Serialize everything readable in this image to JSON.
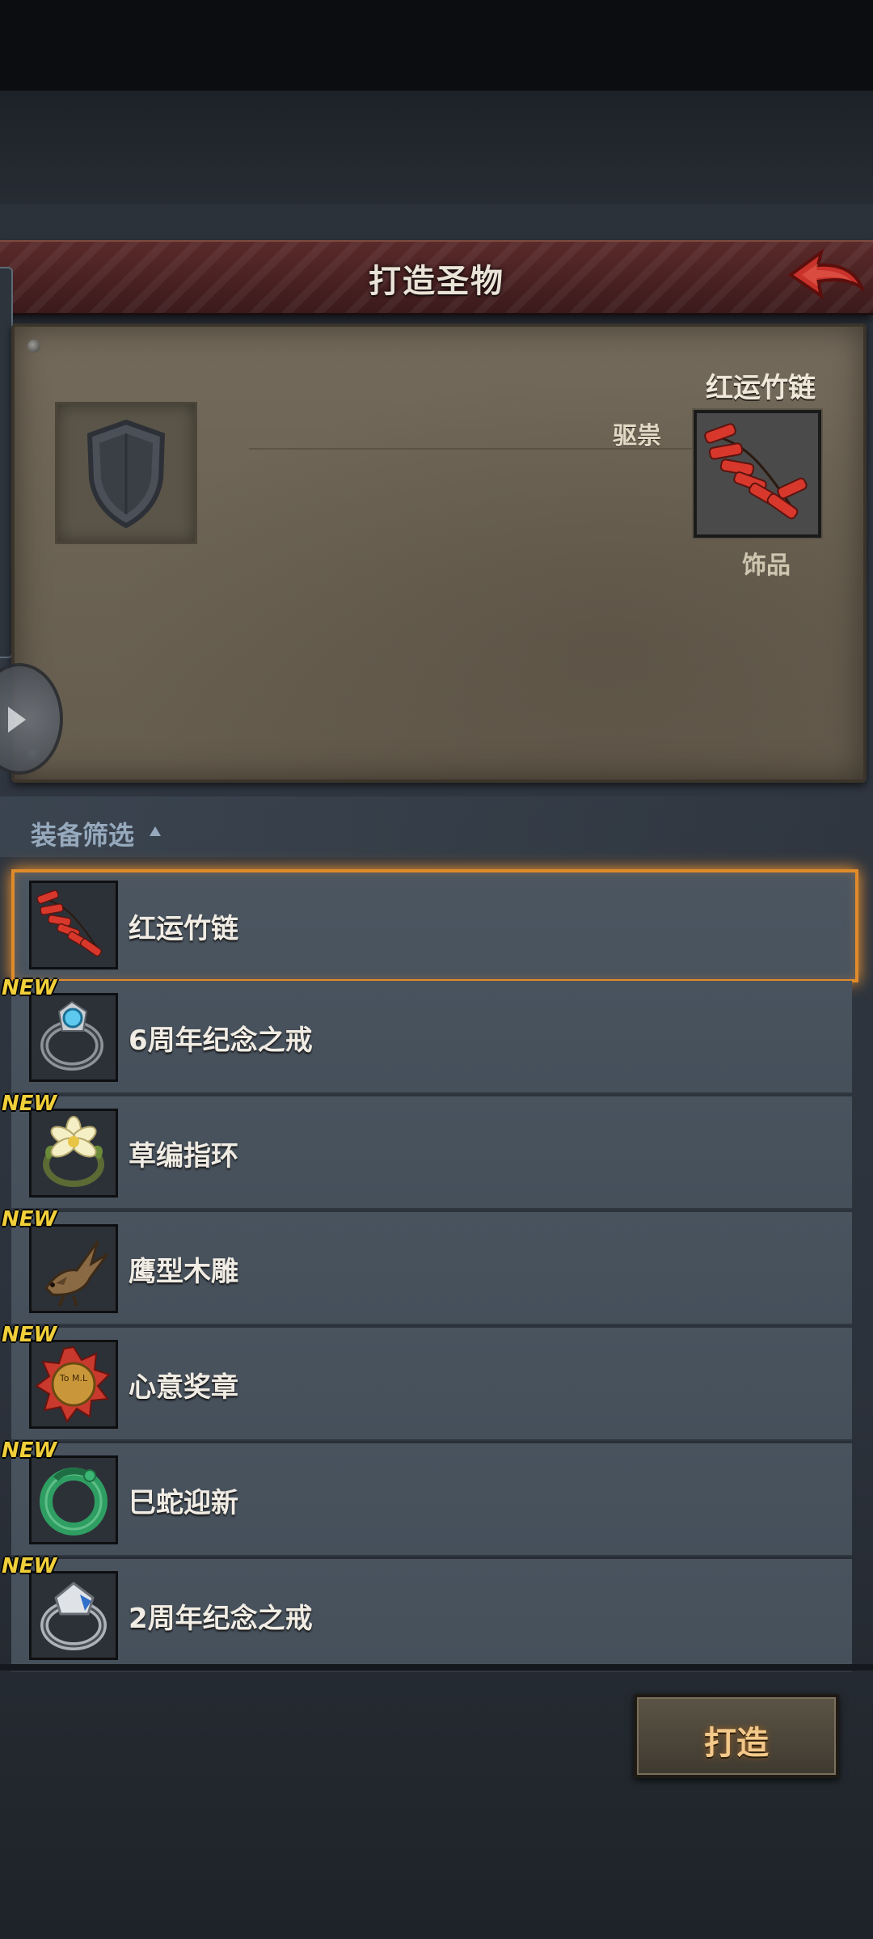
{
  "header": {
    "title": "打造圣物"
  },
  "preview": {
    "attribute": "驱祟",
    "item_name": "红运竹链",
    "item_type": "饰品"
  },
  "filter": {
    "label": "装备筛选"
  },
  "list": {
    "new_badge": "NEW",
    "items": [
      {
        "label": "红运竹链",
        "is_new": false,
        "selected": true,
        "icon": "firecracker-chain-icon"
      },
      {
        "label": "6周年纪念之戒",
        "is_new": true,
        "selected": false,
        "icon": "blue-gem-ring-icon"
      },
      {
        "label": "草编指环",
        "is_new": true,
        "selected": false,
        "icon": "flower-ring-icon"
      },
      {
        "label": "鹰型木雕",
        "is_new": true,
        "selected": false,
        "icon": "eagle-carving-icon"
      },
      {
        "label": "心意奖章",
        "is_new": true,
        "selected": false,
        "icon": "medal-icon"
      },
      {
        "label": "巳蛇迎新",
        "is_new": true,
        "selected": false,
        "icon": "jade-snake-ring-icon"
      },
      {
        "label": "2周年纪念之戒",
        "is_new": true,
        "selected": false,
        "icon": "silver-ring-icon"
      }
    ],
    "medal_text": "To M.L"
  },
  "actions": {
    "forge_label": "打造"
  },
  "colors": {
    "header": "#4a2122",
    "highlight": "#e08b2a",
    "new_badge": "#f1cf3a",
    "button_text": "#f3c98a"
  }
}
